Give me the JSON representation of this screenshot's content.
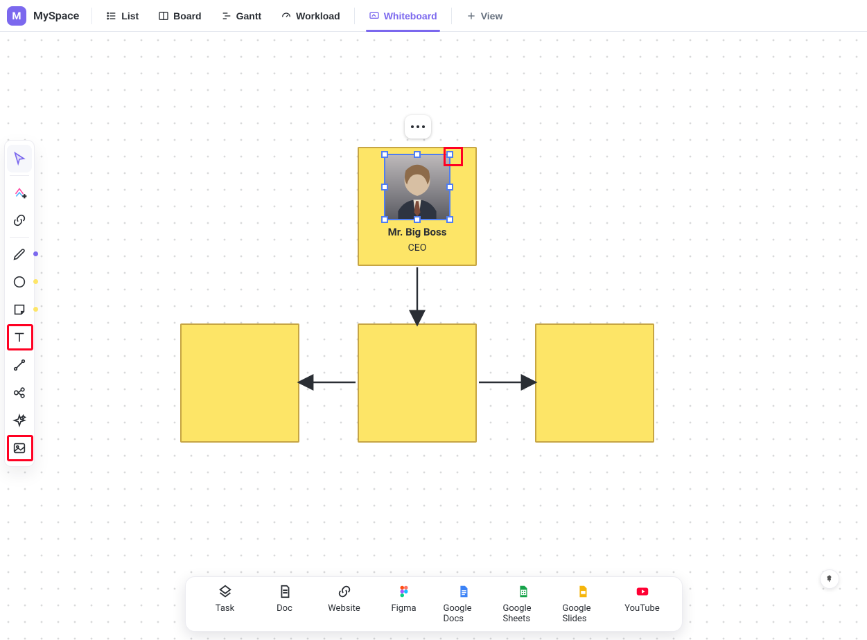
{
  "header": {
    "space_letter": "M",
    "space_name": "MySpace",
    "tabs": {
      "list": "List",
      "board": "Board",
      "gantt": "Gantt",
      "workload": "Workload",
      "whiteboard": "Whiteboard",
      "add_view": "View"
    },
    "active_tab": "whiteboard"
  },
  "whiteboard": {
    "ceo_card": {
      "name": "Mr. Big Boss",
      "role": "CEO"
    }
  },
  "shelf": {
    "task": "Task",
    "doc": "Doc",
    "website": "Website",
    "figma": "Figma",
    "gdocs": "Google Docs",
    "gsheets": "Google Sheets",
    "gslides": "Google Slides",
    "youtube": "YouTube"
  },
  "toolbar": {
    "select": "select",
    "clickup": "clickup",
    "link": "link",
    "pen": "pen",
    "shape": "shape",
    "sticky": "sticky",
    "text": "text",
    "connector": "connector",
    "group": "group",
    "ai": "ai",
    "image": "image"
  }
}
